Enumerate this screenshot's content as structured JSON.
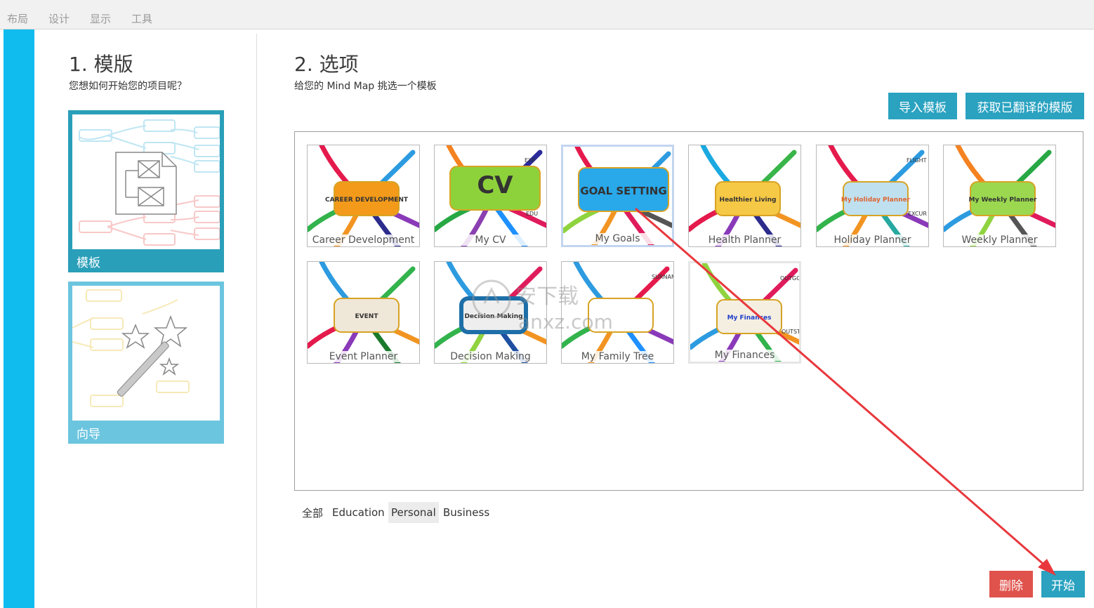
{
  "menu": [
    "布局",
    "设计",
    "显示",
    "工具"
  ],
  "step1": {
    "title": "1. 模版",
    "subtitle": "您想如何开始您的项目呢？"
  },
  "modes": [
    {
      "label": "模板",
      "color": "#2a9fb9"
    },
    {
      "label": "向导",
      "color": "#6cc5df"
    }
  ],
  "step2": {
    "title": "2. 选项",
    "subtitle": "给您的 Mind Map 挑选一个模板"
  },
  "buttons": {
    "import": "导入模板",
    "translated": "获取已翻译的模版",
    "delete": "删除",
    "start": "开始"
  },
  "templates": [
    {
      "caption": "Career Development",
      "center_text": "CAREER DEVELOPMENT",
      "bubble": "#f39a1a"
    },
    {
      "caption": "My CV",
      "center_text": "CV",
      "bubble": "#8ed23b",
      "branch_labels": [
        "EXP",
        "EDU"
      ]
    },
    {
      "caption": "My Goals",
      "center_text": "GOAL SETTING",
      "bubble": "#29a8ea"
    },
    {
      "caption": "Health Planner",
      "center_text": "Healthier Living",
      "bubble": "#f5c845"
    },
    {
      "caption": "Holiday Planner",
      "center_text": "My Holiday Planner",
      "bubble": "#bfe0ef",
      "branch_labels": [
        "FLIGHT",
        "EXCUR"
      ]
    },
    {
      "caption": "Weekly Planner",
      "center_text": "My Weekly Planner",
      "bubble": "#9bd850"
    },
    {
      "caption": "Event Planner",
      "center_text": "EVENT",
      "bubble": "#efe7d8"
    },
    {
      "caption": "Decision Making",
      "center_text": "Decision Making",
      "bubble": "#eeeeee"
    },
    {
      "caption": "My Family Tree",
      "center_text": "",
      "bubble": "#ffffff",
      "branch_labels": [
        "SURNAME"
      ]
    },
    {
      "caption": "My Finances",
      "center_text": "My Finances",
      "bubble": "#f5efe2",
      "branch_labels": [
        "OUTGO",
        "OUTSTAN"
      ]
    }
  ],
  "filters": [
    "全部",
    "Education",
    "Personal",
    "Business"
  ],
  "active_filter": "Personal",
  "selected_template": "My Goals",
  "watermark": {
    "line1": "安下载",
    "line2": "anxz.com"
  }
}
